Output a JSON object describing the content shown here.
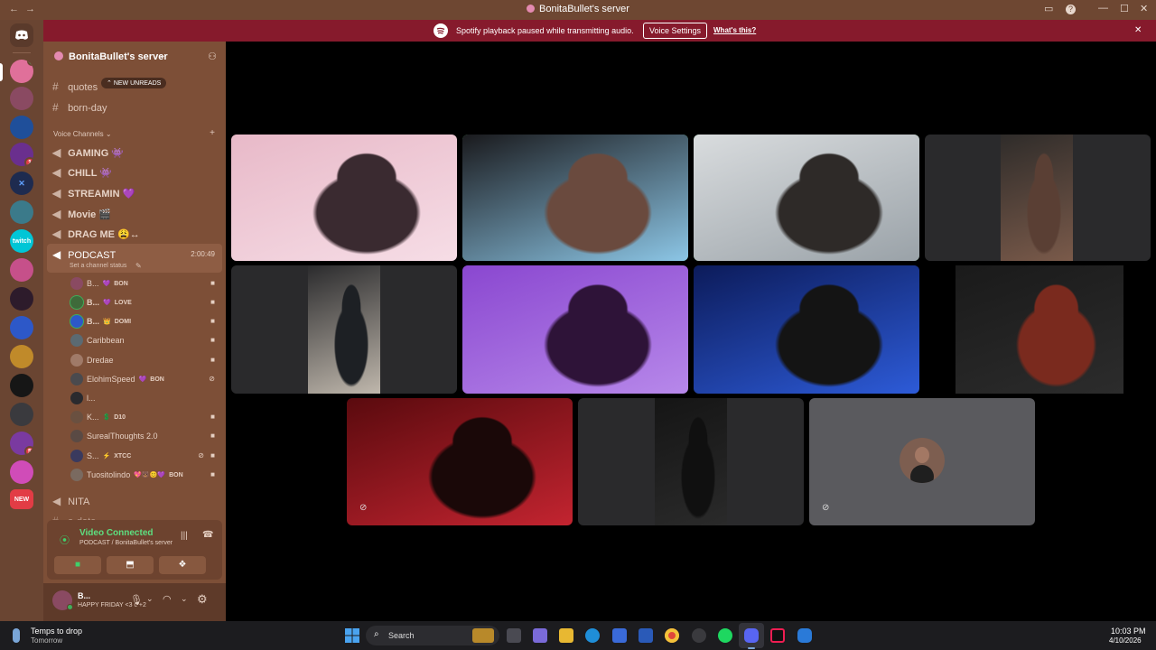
{
  "window": {
    "title": "BonitaBullet's server",
    "back": "←",
    "forward": "→"
  },
  "banner": {
    "message": "Spotify playback paused while transmitting audio.",
    "settings_button": "Voice Settings",
    "link": "What's this?",
    "close": "✕"
  },
  "server": {
    "name": "BonitaBullet's server"
  },
  "guilds": [
    {
      "label": "NEW",
      "is_new": true
    }
  ],
  "channels": {
    "text_top": [
      {
        "name": "quotes"
      },
      {
        "name": "born-day"
      }
    ],
    "new_unreads": "NEW UNREADS",
    "voice_header": "Voice Channels",
    "voice": [
      {
        "name": "GAMING",
        "emoji": "👾"
      },
      {
        "name": "CHILL",
        "emoji": "👾"
      },
      {
        "name": "STREAMIN",
        "emoji": "💜"
      },
      {
        "name": "Movie",
        "emoji": "🎬"
      },
      {
        "name": "DRAG ME",
        "emoji": "😩↔"
      }
    ],
    "active": {
      "name": "PODCAST",
      "timer": "2:00:49",
      "status": "Set a channel status"
    },
    "members": [
      {
        "name": "B...",
        "tag": "BON",
        "tag_icon": "💜",
        "bold": false
      },
      {
        "name": "B...",
        "tag": "LOVE",
        "tag_icon": "💜",
        "bold": true
      },
      {
        "name": "B...",
        "tag": "DOMI",
        "tag_icon": "👑",
        "bold": true
      },
      {
        "name": "Caribbean",
        "tag": "",
        "tag_icon": "",
        "bold": false
      },
      {
        "name": "Dredae",
        "tag": "",
        "tag_icon": "",
        "bold": false
      },
      {
        "name": "ElohimSpeed",
        "tag": "BON",
        "tag_icon": "💜",
        "bold": false
      },
      {
        "name": "l...",
        "tag": "",
        "tag_icon": "",
        "bold": false
      },
      {
        "name": "K...",
        "tag": "D10",
        "tag_icon": "💲",
        "bold": false
      },
      {
        "name": "SurealThoughts 2.0",
        "tag": "",
        "tag_icon": "",
        "bold": false
      },
      {
        "name": "S...",
        "tag": "XTCC",
        "tag_icon": "⚡",
        "bold": false
      },
      {
        "name": "Tuositolindo",
        "tag": "BON",
        "tag_icon": "💖🐻😊💜",
        "bold": false
      }
    ],
    "text_bottom": [
      {
        "name": "NITA"
      },
      {
        "name": "a-date"
      }
    ]
  },
  "voice_panel": {
    "status": "Video Connected",
    "location": "PODCAST / BonitaBullet's server"
  },
  "user_panel": {
    "name": "B...",
    "status": "HAPPY FRIDAY <3 c +2"
  },
  "tiles": [
    {
      "name": "pink-room",
      "colors": [
        "#e8b9c8",
        "#f6dde6",
        "#3a2a30"
      ]
    },
    {
      "name": "blue-shirt",
      "colors": [
        "#1a1a1d",
        "#8cc6e6",
        "#6a4a3e"
      ]
    },
    {
      "name": "cap-man",
      "colors": [
        "#d9dcde",
        "#9aa2a8",
        "#2e2a28"
      ]
    },
    {
      "name": "portrait-right",
      "colors": [
        "#2f2c2a",
        "#7a5a4a",
        "#5a3f34"
      ]
    },
    {
      "name": "hoodie-man",
      "colors": [
        "#2b2b2d",
        "#bfb7ac",
        "#1d2024"
      ]
    },
    {
      "name": "purple-room",
      "colors": [
        "#8a47d0",
        "#b788ea",
        "#2e1338"
      ]
    },
    {
      "name": "blue-light",
      "colors": [
        "#0c1b5a",
        "#2d5bd8",
        "#141414"
      ]
    },
    {
      "name": "dark-beanie",
      "colors": [
        "#1a1a1a",
        "#2c2c2c",
        "#7a2a1e"
      ]
    },
    {
      "name": "red-room",
      "colors": [
        "#5a0a0e",
        "#c32430",
        "#1a0808"
      ]
    },
    {
      "name": "dim-portrait",
      "colors": [
        "#151515",
        "#2a2a2a",
        "#101010"
      ]
    },
    {
      "name": "avatar-tile",
      "colors": [
        "#5a5a5e",
        "#7a7a7e",
        "#4a4a4e"
      ]
    }
  ],
  "taskbar": {
    "weather_title": "Temps to drop",
    "weather_sub": "Tomorrow",
    "search": "Search",
    "time": "10:03 PM",
    "date": "4/10/2026"
  }
}
